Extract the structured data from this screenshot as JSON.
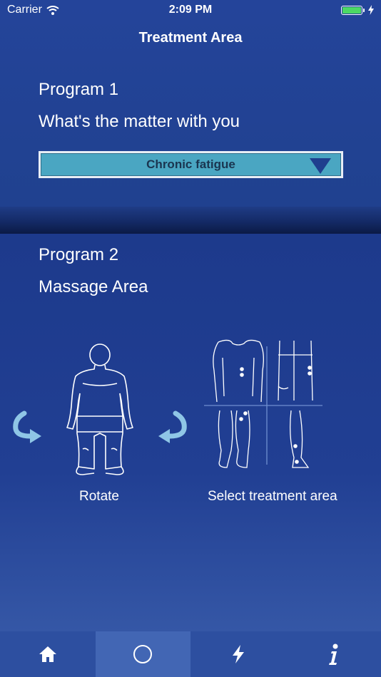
{
  "status_bar": {
    "carrier": "Carrier",
    "time": "2:09 PM"
  },
  "nav": {
    "title": "Treatment Area"
  },
  "program1": {
    "title": "Program 1",
    "question": "What's the matter with you",
    "dropdown_value": "Chronic fatigue"
  },
  "program2": {
    "title": "Program 2",
    "subtitle": "Massage Area",
    "rotate_label": "Rotate",
    "select_area_label": "Select treatment area"
  },
  "tab_bar": {
    "tabs": [
      {
        "icon": "home-icon",
        "active": false
      },
      {
        "icon": "circle-icon",
        "active": true
      },
      {
        "icon": "lightning-icon",
        "active": false
      },
      {
        "icon": "info-icon",
        "active": false
      }
    ]
  },
  "colors": {
    "background": "#1e3d8f",
    "dropdown": "#4aa6c2",
    "tab_bar": "#2d4fa0",
    "tab_active": "#4266b4",
    "arrow": "#8fc6e6",
    "battery": "#4cd964"
  }
}
